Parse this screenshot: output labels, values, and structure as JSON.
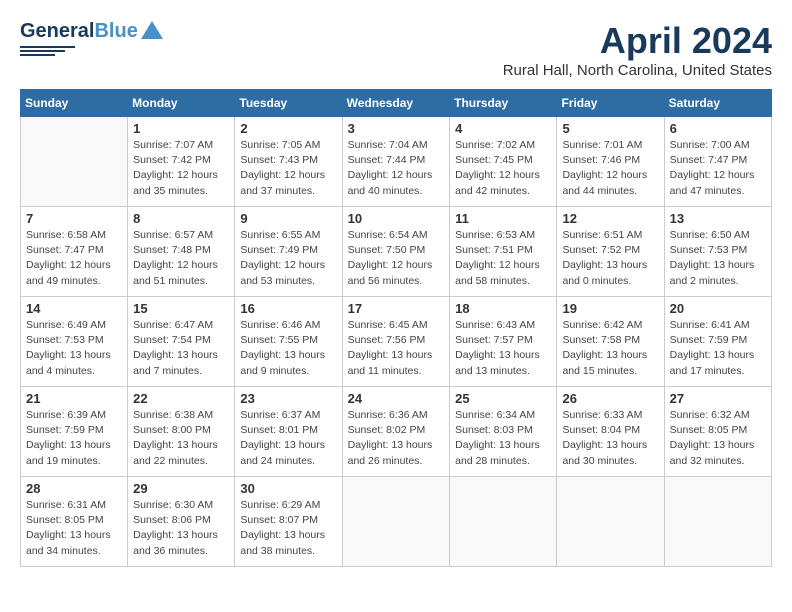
{
  "header": {
    "logo_line1": "General",
    "logo_line2": "Blue",
    "month": "April 2024",
    "location": "Rural Hall, North Carolina, United States"
  },
  "weekdays": [
    "Sunday",
    "Monday",
    "Tuesday",
    "Wednesday",
    "Thursday",
    "Friday",
    "Saturday"
  ],
  "weeks": [
    [
      {
        "day": "",
        "info": ""
      },
      {
        "day": "1",
        "info": "Sunrise: 7:07 AM\nSunset: 7:42 PM\nDaylight: 12 hours\nand 35 minutes."
      },
      {
        "day": "2",
        "info": "Sunrise: 7:05 AM\nSunset: 7:43 PM\nDaylight: 12 hours\nand 37 minutes."
      },
      {
        "day": "3",
        "info": "Sunrise: 7:04 AM\nSunset: 7:44 PM\nDaylight: 12 hours\nand 40 minutes."
      },
      {
        "day": "4",
        "info": "Sunrise: 7:02 AM\nSunset: 7:45 PM\nDaylight: 12 hours\nand 42 minutes."
      },
      {
        "day": "5",
        "info": "Sunrise: 7:01 AM\nSunset: 7:46 PM\nDaylight: 12 hours\nand 44 minutes."
      },
      {
        "day": "6",
        "info": "Sunrise: 7:00 AM\nSunset: 7:47 PM\nDaylight: 12 hours\nand 47 minutes."
      }
    ],
    [
      {
        "day": "7",
        "info": "Sunrise: 6:58 AM\nSunset: 7:47 PM\nDaylight: 12 hours\nand 49 minutes."
      },
      {
        "day": "8",
        "info": "Sunrise: 6:57 AM\nSunset: 7:48 PM\nDaylight: 12 hours\nand 51 minutes."
      },
      {
        "day": "9",
        "info": "Sunrise: 6:55 AM\nSunset: 7:49 PM\nDaylight: 12 hours\nand 53 minutes."
      },
      {
        "day": "10",
        "info": "Sunrise: 6:54 AM\nSunset: 7:50 PM\nDaylight: 12 hours\nand 56 minutes."
      },
      {
        "day": "11",
        "info": "Sunrise: 6:53 AM\nSunset: 7:51 PM\nDaylight: 12 hours\nand 58 minutes."
      },
      {
        "day": "12",
        "info": "Sunrise: 6:51 AM\nSunset: 7:52 PM\nDaylight: 13 hours\nand 0 minutes."
      },
      {
        "day": "13",
        "info": "Sunrise: 6:50 AM\nSunset: 7:53 PM\nDaylight: 13 hours\nand 2 minutes."
      }
    ],
    [
      {
        "day": "14",
        "info": "Sunrise: 6:49 AM\nSunset: 7:53 PM\nDaylight: 13 hours\nand 4 minutes."
      },
      {
        "day": "15",
        "info": "Sunrise: 6:47 AM\nSunset: 7:54 PM\nDaylight: 13 hours\nand 7 minutes."
      },
      {
        "day": "16",
        "info": "Sunrise: 6:46 AM\nSunset: 7:55 PM\nDaylight: 13 hours\nand 9 minutes."
      },
      {
        "day": "17",
        "info": "Sunrise: 6:45 AM\nSunset: 7:56 PM\nDaylight: 13 hours\nand 11 minutes."
      },
      {
        "day": "18",
        "info": "Sunrise: 6:43 AM\nSunset: 7:57 PM\nDaylight: 13 hours\nand 13 minutes."
      },
      {
        "day": "19",
        "info": "Sunrise: 6:42 AM\nSunset: 7:58 PM\nDaylight: 13 hours\nand 15 minutes."
      },
      {
        "day": "20",
        "info": "Sunrise: 6:41 AM\nSunset: 7:59 PM\nDaylight: 13 hours\nand 17 minutes."
      }
    ],
    [
      {
        "day": "21",
        "info": "Sunrise: 6:39 AM\nSunset: 7:59 PM\nDaylight: 13 hours\nand 19 minutes."
      },
      {
        "day": "22",
        "info": "Sunrise: 6:38 AM\nSunset: 8:00 PM\nDaylight: 13 hours\nand 22 minutes."
      },
      {
        "day": "23",
        "info": "Sunrise: 6:37 AM\nSunset: 8:01 PM\nDaylight: 13 hours\nand 24 minutes."
      },
      {
        "day": "24",
        "info": "Sunrise: 6:36 AM\nSunset: 8:02 PM\nDaylight: 13 hours\nand 26 minutes."
      },
      {
        "day": "25",
        "info": "Sunrise: 6:34 AM\nSunset: 8:03 PM\nDaylight: 13 hours\nand 28 minutes."
      },
      {
        "day": "26",
        "info": "Sunrise: 6:33 AM\nSunset: 8:04 PM\nDaylight: 13 hours\nand 30 minutes."
      },
      {
        "day": "27",
        "info": "Sunrise: 6:32 AM\nSunset: 8:05 PM\nDaylight: 13 hours\nand 32 minutes."
      }
    ],
    [
      {
        "day": "28",
        "info": "Sunrise: 6:31 AM\nSunset: 8:05 PM\nDaylight: 13 hours\nand 34 minutes."
      },
      {
        "day": "29",
        "info": "Sunrise: 6:30 AM\nSunset: 8:06 PM\nDaylight: 13 hours\nand 36 minutes."
      },
      {
        "day": "30",
        "info": "Sunrise: 6:29 AM\nSunset: 8:07 PM\nDaylight: 13 hours\nand 38 minutes."
      },
      {
        "day": "",
        "info": ""
      },
      {
        "day": "",
        "info": ""
      },
      {
        "day": "",
        "info": ""
      },
      {
        "day": "",
        "info": ""
      }
    ]
  ]
}
